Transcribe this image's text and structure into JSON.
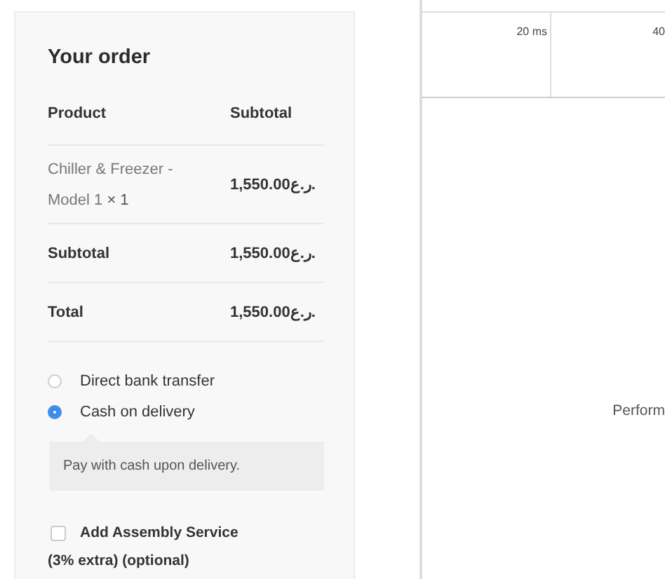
{
  "order": {
    "title": "Your order",
    "columns": [
      "Product",
      "Subtotal"
    ],
    "items": [
      {
        "name": "Chiller & Freezer - Model 1",
        "quantity": "× 1",
        "subtotal": "1,550.00ر.ع."
      }
    ],
    "totals": [
      {
        "label": "Subtotal",
        "value": "1,550.00ر.ع."
      },
      {
        "label": "Total",
        "value": "1,550.00ر.ع."
      }
    ],
    "payment_methods": [
      {
        "label": "Direct bank transfer",
        "selected": false
      },
      {
        "label": "Cash on delivery",
        "selected": true,
        "description": "Pay with cash upon delivery."
      }
    ],
    "addon": {
      "label": "Add Assembly Service (3% extra) (optional)",
      "checked": false
    }
  },
  "devtools": {
    "ticks": [
      "20 ms",
      "40"
    ],
    "message": "Perform"
  }
}
